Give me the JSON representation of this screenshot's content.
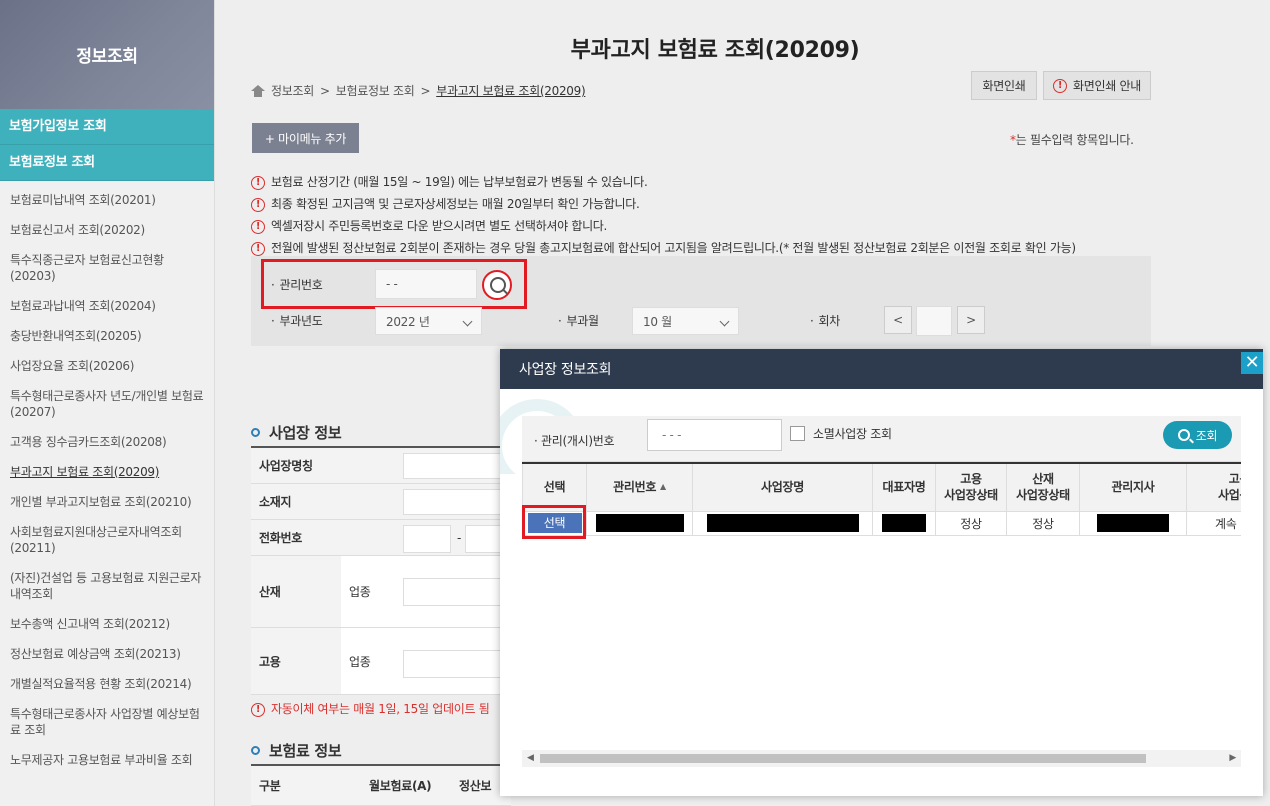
{
  "sidebar": {
    "title": "정보조회",
    "categories": [
      "보험가입정보 조회",
      "보험료정보 조회"
    ],
    "items": [
      "보험료미납내역 조회(20201)",
      "보험료신고서 조회(20202)",
      "특수직종근로자 보험료신고현황(20203)",
      "보험료과납내역 조회(20204)",
      "충당반환내역조회(20205)",
      "사업장요율 조회(20206)",
      "특수형태근로종사자 년도/개인별 보험료(20207)",
      "고객용 징수금카드조회(20208)",
      "부과고지 보험료 조회(20209)",
      "개인별 부과고지보험료 조회(20210)",
      "사회보험료지원대상근로자내역조회(20211)",
      "(자진)건설업 등 고용보험료 지원근로자 내역조회",
      "보수총액 신고내역 조회(20212)",
      "정산보험료 예상금액 조회(20213)",
      "개별실적요율적용 현황 조회(20214)",
      "특수형태근로종사자 사업장별 예상보험료 조회",
      "노무제공자 고용보험료 부과비율 조회"
    ]
  },
  "page": {
    "title": "부과고지 보험료 조회(20209)",
    "breadcrumb": [
      "정보조회",
      "보험료정보 조회",
      "부과고지 보험료 조회(20209)"
    ],
    "print_btn": "화면인쇄",
    "print_guide_btn": "화면인쇄 안내",
    "mymenu_btn": "+ 마이메뉴 추가",
    "required_note": "는 필수입력 항목입니다.",
    "notes": [
      "보험료 산정기간 (매월 15일 ~ 19일) 에는 납부보험료가 변동될 수 있습니다.",
      "최종 확정된 고지금액 및 근로자상세정보는 매월 20일부터 확인 가능합니다.",
      "엑셀저장시 주민등록번호로 다운 받으시려면 별도 선택하셔야 합니다.",
      "전월에 발생된 정산보험료 2회분이 존재하는 경우 당월 총고지보험료에 합산되어 고지됨을 알려드립니다.(* 전월 발생된 정산보험료 2회분은 이전월 조회로 확인 가능)"
    ]
  },
  "search": {
    "mgmt_label": "관리번호",
    "mgmt_placeholder": "- -",
    "year_label": "부과년도",
    "year_value": "2022 년",
    "month_label": "부과월",
    "month_value": "10 월",
    "round_label": "회차",
    "prev": "<",
    "next": ">"
  },
  "workplace": {
    "title": "사업장 정보",
    "rows": [
      "사업장명칭",
      "소재지",
      "전화번호",
      "산재",
      "고용"
    ],
    "sub_label": "업종",
    "phone_sep": "-"
  },
  "warning": "자동이체 여부는 매월 1일, 15일 업데이트 됨",
  "premium": {
    "title": "보험료 정보",
    "headers": [
      "구분",
      "월보험료(A)",
      "정산보"
    ]
  },
  "modal": {
    "title": "사업장 정보조회",
    "close": "✕",
    "mgmt_label": "관리(개시)번호",
    "mgmt_placeholder": "- - -",
    "closed_label": "소멸사업장 조회",
    "search_btn": "조회",
    "headers": [
      "선택",
      "관리번호",
      "사업장명",
      "대표자명",
      "고용\n사업장상태",
      "산재\n사업장상태",
      "관리지사",
      "고용\n사업구분"
    ],
    "row": {
      "select": "선택",
      "emp_status": "정상",
      "ind_status": "정상",
      "type": "계속"
    }
  }
}
